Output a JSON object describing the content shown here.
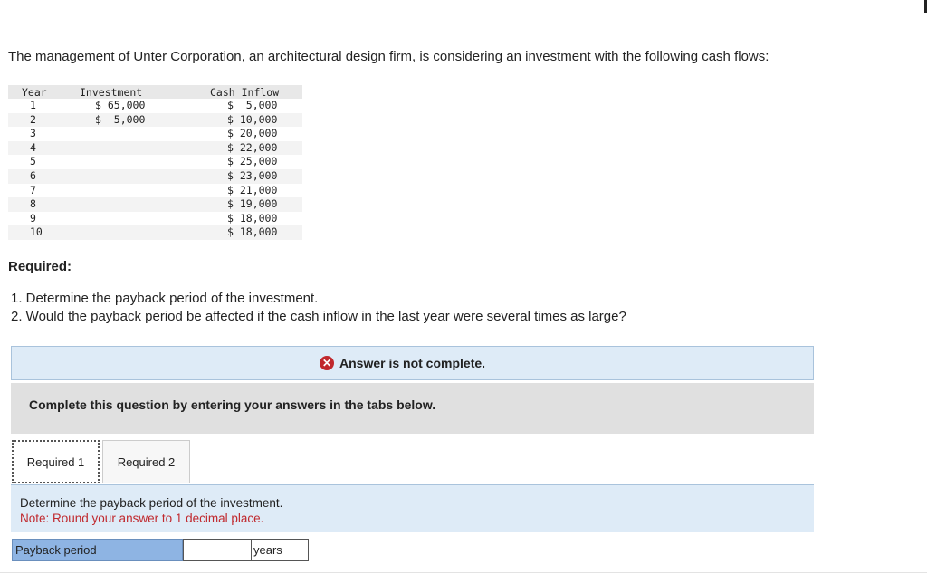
{
  "intro": "The management of Unter Corporation, an architectural design firm, is considering an investment with the following cash flows:",
  "table": {
    "headers": [
      "Year",
      "Investment",
      "Cash Inflow"
    ],
    "rows": [
      {
        "year": "1",
        "investment": "$ 65,000",
        "cash": "$  5,000"
      },
      {
        "year": "2",
        "investment": "$  5,000",
        "cash": "$ 10,000"
      },
      {
        "year": "3",
        "investment": "",
        "cash": "$ 20,000"
      },
      {
        "year": "4",
        "investment": "",
        "cash": "$ 22,000"
      },
      {
        "year": "5",
        "investment": "",
        "cash": "$ 25,000"
      },
      {
        "year": "6",
        "investment": "",
        "cash": "$ 23,000"
      },
      {
        "year": "7",
        "investment": "",
        "cash": "$ 21,000"
      },
      {
        "year": "8",
        "investment": "",
        "cash": "$ 19,000"
      },
      {
        "year": "9",
        "investment": "",
        "cash": "$ 18,000"
      },
      {
        "year": "10",
        "investment": "",
        "cash": "$ 18,000"
      }
    ]
  },
  "required": {
    "heading": "Required:",
    "items": [
      "1. Determine the payback period of the investment.",
      "2. Would the payback period be affected if the cash inflow in the last year were several times as large?"
    ]
  },
  "alert": {
    "icon": "x-circle-icon",
    "text": "Answer is not complete."
  },
  "instructions": "Complete this question by entering your answers in the tabs below.",
  "tabs": [
    "Required 1",
    "Required 2"
  ],
  "question": {
    "prompt": "Determine the payback period of the investment.",
    "note": "Note: Round your answer to 1 decimal place."
  },
  "answer": {
    "label": "Payback period",
    "value": "",
    "unit": "years"
  },
  "colors": {
    "alert_bg": "#deebf7",
    "note_red": "#c0282d",
    "label_blue": "#8eb4e3"
  }
}
